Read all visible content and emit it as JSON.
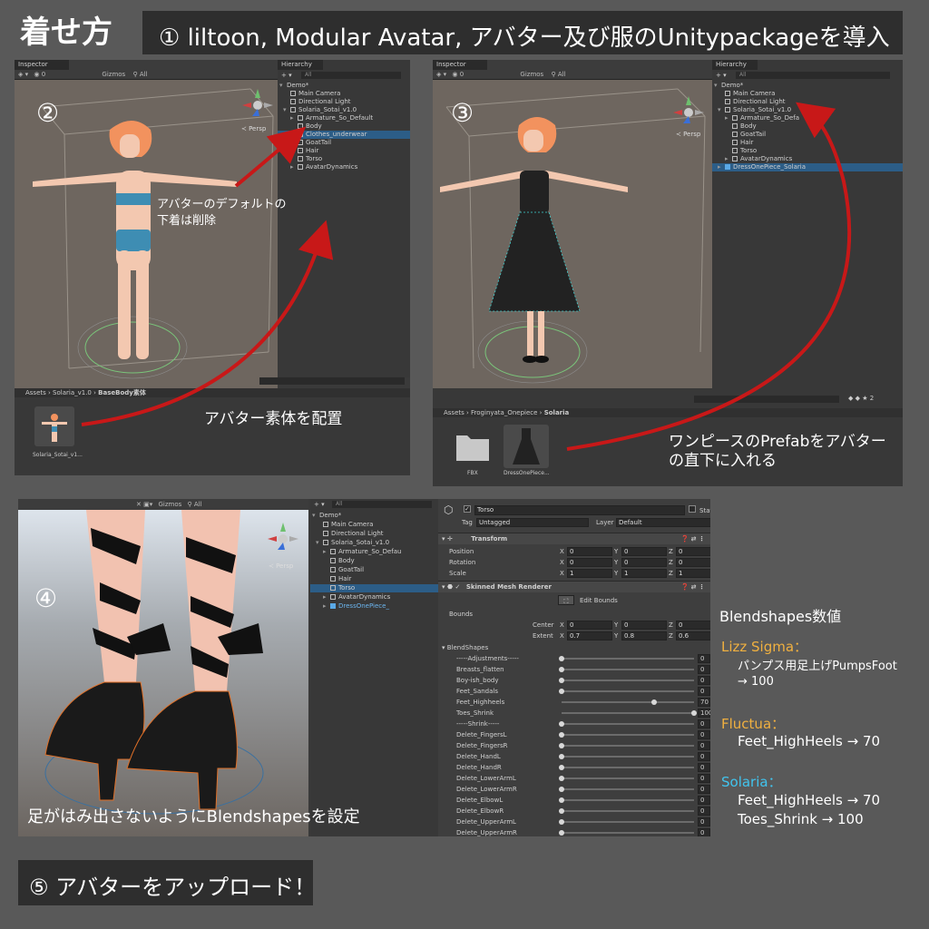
{
  "title": "着せ方",
  "step1": "① liltoon, Modular Avatar, アバター及び服のUnitypackageを導入",
  "common": {
    "inspector_tab": "Inspector",
    "hierarchy_tab": "Hierarchy",
    "gizmos": "Gizmos",
    "search_all": "All",
    "persp": "≺ Persp",
    "zero": "0"
  },
  "panel2": {
    "number": "②",
    "hierarchy": [
      "Demo*",
      "Main Camera",
      "Directional Light",
      "Solaria_Sotai_v1.0",
      "Armature_So_Default",
      "Body",
      "Clothes_underwear",
      "GoatTail",
      "Hair",
      "Torso",
      "AvatarDynamics"
    ],
    "annotation_delete": [
      "アバターのデフォルトの",
      "下着は削除"
    ],
    "annotation_place": "アバター素体を配置",
    "breadcrumb": [
      "Assets",
      "Solaria_v1.0",
      "BaseBody素体"
    ],
    "asset_label": "Solaria_Sotai_v1..."
  },
  "panel3": {
    "number": "③",
    "hierarchy": [
      "Demo*",
      "Main Camera",
      "Directional Light",
      "Solaria_Sotai_v1.0",
      "Armature_So_Defa",
      "Body",
      "GoatTail",
      "Hair",
      "Torso",
      "AvatarDynamics",
      "DressOnePiece_Solaria"
    ],
    "annotation": [
      "ワンピースのPrefabをアバター",
      "の直下に入れる"
    ],
    "breadcrumb": [
      "Assets",
      "Froginyata_Onepiece",
      "Solaria"
    ],
    "asset_labels": [
      "FBX",
      "DressOnePiece..."
    ],
    "counter": "2"
  },
  "panel4": {
    "number": "④",
    "annotation": "足がはみ出さないようにBlendshapesを設定",
    "hierarchy": [
      "Demo*",
      "Main Camera",
      "Directional Light",
      "Solaria_Sotai_v1.0",
      "Armature_So_Defau",
      "Body",
      "GoatTail",
      "Hair",
      "Torso",
      "AvatarDynamics",
      "DressOnePiece_"
    ],
    "inspector": {
      "object_name": "Torso",
      "static_label": "Static",
      "tag_label": "Tag",
      "tag_value": "Untagged",
      "layer_label": "Layer",
      "layer_value": "Default",
      "transform_label": "Transform",
      "position_label": "Position",
      "rotation_label": "Rotation",
      "scale_label": "Scale",
      "position": [
        "0",
        "0",
        "0"
      ],
      "rotation": [
        "0",
        "0",
        "0"
      ],
      "scale": [
        "1",
        "1",
        "1"
      ],
      "smr_label": "Skinned Mesh Renderer",
      "edit_bounds": "Edit Bounds",
      "bounds_label": "Bounds",
      "center_label": "Center",
      "extent_label": "Extent",
      "center": [
        "0",
        "0",
        "0"
      ],
      "extent": [
        "0.7",
        "0.8",
        "0.6"
      ],
      "axis": [
        "X",
        "Y",
        "Z"
      ],
      "blendshapes_label": "BlendShapes",
      "blendshapes": [
        {
          "name": "-----Adjustments-----",
          "value": 0
        },
        {
          "name": "Breasts_flatten",
          "value": 0
        },
        {
          "name": "Boy-ish_body",
          "value": 0
        },
        {
          "name": "Feet_Sandals",
          "value": 0
        },
        {
          "name": "Feet_Highheels",
          "value": 70
        },
        {
          "name": "Toes_Shrink",
          "value": 100
        },
        {
          "name": "-----Shrink-----",
          "value": 0
        },
        {
          "name": "Delete_FingersL",
          "value": 0
        },
        {
          "name": "Delete_FingersR",
          "value": 0
        },
        {
          "name": "Delete_HandL",
          "value": 0
        },
        {
          "name": "Delete_HandR",
          "value": 0
        },
        {
          "name": "Delete_LowerArmL",
          "value": 0
        },
        {
          "name": "Delete_LowerArmR",
          "value": 0
        },
        {
          "name": "Delete_ElbowL",
          "value": 0
        },
        {
          "name": "Delete_ElbowR",
          "value": 0
        },
        {
          "name": "Delete_UpperArmL",
          "value": 0
        },
        {
          "name": "Delete_UpperArmR",
          "value": 0
        }
      ]
    }
  },
  "blendshape_notes": {
    "title": "Blendshapes数値",
    "lizz_name": "Lizz Sigma：",
    "lizz_value1": "パンプス用足上げPumpsFoot",
    "lizz_value2": "→ 100",
    "fluctua_name": "Fluctua：",
    "fluctua_value": "Feet_HighHeels → 70",
    "solaria_name": "Solaria：",
    "solaria_value1": "Feet_HighHeels → 70",
    "solaria_value2": "Toes_Shrink → 100"
  },
  "step5": "⑤ アバターをアップロード！",
  "colors": {
    "background": "#595959",
    "arrow": "#c81818",
    "selection": "#2c5d87",
    "lizz": "#f0b040",
    "solaria": "#41c4ee"
  }
}
